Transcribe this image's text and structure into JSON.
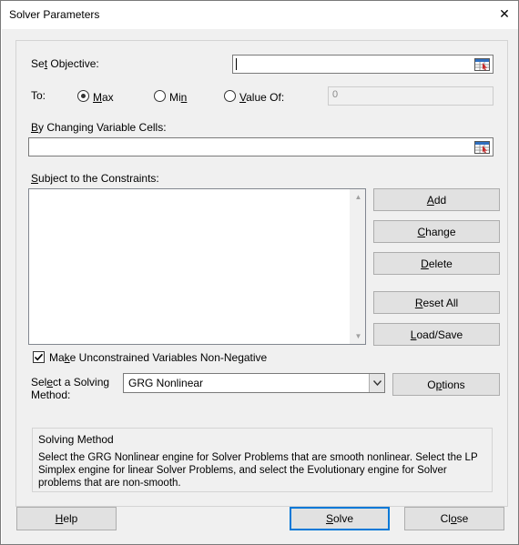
{
  "window": {
    "title": "Solver Parameters",
    "close_glyph": "✕"
  },
  "objective": {
    "label_prefix": "Se",
    "label_mnemonic": "t",
    "label_suffix": " Objective:",
    "value": ""
  },
  "to": {
    "label": "To:",
    "options": [
      {
        "mnemonic": "M",
        "rest": "ax",
        "checked": true
      },
      {
        "prefix": "Mi",
        "mnemonic": "n",
        "rest": "",
        "checked": false
      },
      {
        "mnemonic": "V",
        "rest": "alue Of:",
        "checked": false
      }
    ],
    "value_of": "0"
  },
  "changing": {
    "label_mnemonic": "B",
    "label_rest": "y Changing Variable Cells:",
    "value": ""
  },
  "constraints": {
    "label_mnemonic": "S",
    "label_rest": "ubject to the Constraints:",
    "items": []
  },
  "buttons": {
    "add": {
      "mnemonic": "A",
      "rest": "dd"
    },
    "change": {
      "mnemonic": "C",
      "rest": "hange"
    },
    "delete": {
      "mnemonic": "D",
      "rest": "elete"
    },
    "reset_all": {
      "mnemonic": "R",
      "rest": "eset All"
    },
    "load_save": {
      "mnemonic": "L",
      "rest": "oad/Save"
    },
    "options": {
      "prefix": "O",
      "mnemonic": "p",
      "rest": "tions"
    },
    "help": {
      "mnemonic": "H",
      "rest": "elp"
    },
    "solve": {
      "mnemonic": "S",
      "rest": "olve"
    },
    "close": {
      "prefix": "Cl",
      "mnemonic": "o",
      "rest": "se"
    }
  },
  "nonneg": {
    "checked": true,
    "prefix": "Ma",
    "mnemonic": "k",
    "rest": "e Unconstrained Variables Non-Negative"
  },
  "method": {
    "label_line1_prefix": "Sel",
    "label_mnemonic": "e",
    "label_line1_rest": "ct a Solving",
    "label_line2": "Method:",
    "selected": "GRG Nonlinear"
  },
  "solving_method": {
    "heading": "Solving Method",
    "text": "Select the GRG Nonlinear engine for Solver Problems that are smooth nonlinear. Select the LP Simplex engine for linear Solver Problems, and select the Evolutionary engine for Solver problems that are non-smooth."
  },
  "colors": {
    "accent": "#0078d7",
    "background": "#f0f0f0"
  }
}
